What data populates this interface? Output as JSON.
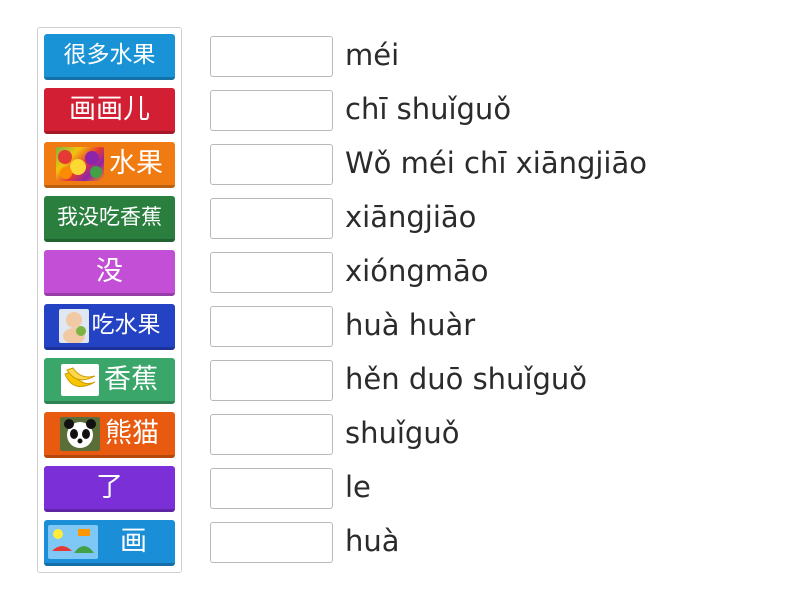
{
  "tiles": [
    {
      "text": "很多水果",
      "color": "#1a93d6",
      "image": null
    },
    {
      "text": "画画儿",
      "color": "#d31f33",
      "image": null
    },
    {
      "text": "水果",
      "color": "#f07b12",
      "image": "fruit-photo"
    },
    {
      "text": "我没吃香蕉",
      "color": "#2a7f3f",
      "image": null
    },
    {
      "text": "没",
      "color": "#c24fd6",
      "image": null
    },
    {
      "text": "吃水果",
      "color": "#2342c4",
      "image": "baby-eating-photo"
    },
    {
      "text": "香蕉",
      "color": "#3aa66a",
      "image": "banana-photo"
    },
    {
      "text": "熊猫",
      "color": "#e85a10",
      "image": "panda-photo"
    },
    {
      "text": "了",
      "color": "#7b2fd6",
      "image": null
    },
    {
      "text": "画",
      "color": "#1a8fd8",
      "image": "drawing-photo"
    }
  ],
  "answers": [
    "méi",
    "chī shuǐguǒ",
    "Wǒ méi chī xiāngjiāo",
    "xiāngjiāo",
    "xióngmāo",
    "huà huàr",
    "hěn duō shuǐguǒ",
    "shuǐguǒ",
    "le",
    "huà"
  ]
}
